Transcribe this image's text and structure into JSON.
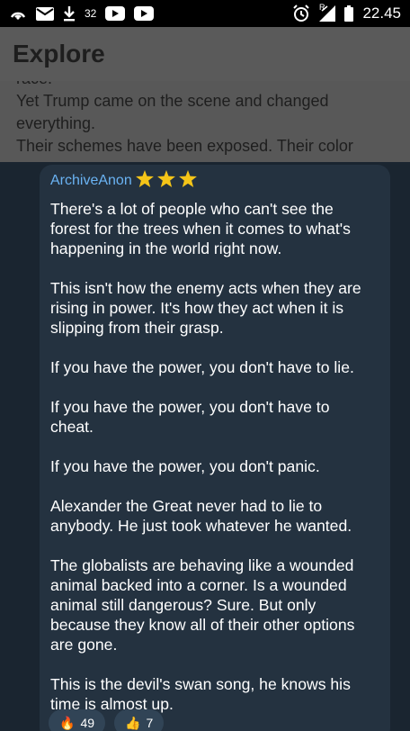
{
  "status_bar": {
    "download_count": "32",
    "time": "22.45",
    "signal_label": "R"
  },
  "header": {
    "title": "Explore"
  },
  "article": {
    "lines": [
      "race.",
      "Yet Trump came on the scene and changed",
      "everything.",
      "Their schemes have been exposed. Their color"
    ]
  },
  "message": {
    "author": "ArchiveAnon",
    "paragraphs": [
      [
        "There's a lot of people who can't see the",
        "forest for the trees when it comes to what's",
        "happening in the world right now."
      ],
      [
        "This isn't how the enemy acts when they are",
        "rising in power. It's how they act when it is",
        "slipping from their grasp."
      ],
      [
        "If you have the power, you don't have to lie."
      ],
      [
        "If you have the power, you don't have to",
        "cheat."
      ],
      [
        "If you have the power, you don't panic."
      ],
      [
        "Alexander the Great never had to lie to",
        "anybody. He just took whatever he wanted."
      ],
      [
        "The globalists are behaving like a wounded",
        "animal backed into a corner. Is a wounded",
        "animal still dangerous? Sure. But only",
        "because they know all of their other options",
        "are gone."
      ],
      [
        "This is the devil's swan song, he knows his",
        "time is almost up."
      ]
    ]
  },
  "reactions": [
    {
      "emoji": "🔥",
      "count": "49"
    },
    {
      "emoji": "👍",
      "count": "7"
    }
  ],
  "colors": {
    "author": "#6ab3f3",
    "bubble": "#243240",
    "star": "#f5c518"
  }
}
